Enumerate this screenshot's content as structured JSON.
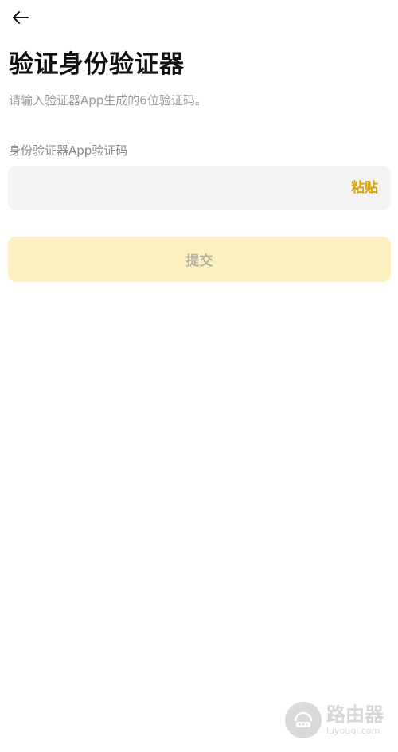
{
  "header": {
    "back_icon": "arrow-left-icon"
  },
  "page": {
    "title": "验证身份验证器",
    "subtitle": "请输入验证器App生成的6位验证码。"
  },
  "form": {
    "field_label": "身份验证器App验证码",
    "code_value": "",
    "code_placeholder": "",
    "paste_label": "粘贴",
    "submit_label": "提交"
  },
  "watermark": {
    "name": "路由器",
    "url": "luyouqi.com"
  },
  "colors": {
    "accent": "#d9a400",
    "submit_disabled_bg": "#fdf0c0",
    "field_bg": "#f4f4f4"
  }
}
